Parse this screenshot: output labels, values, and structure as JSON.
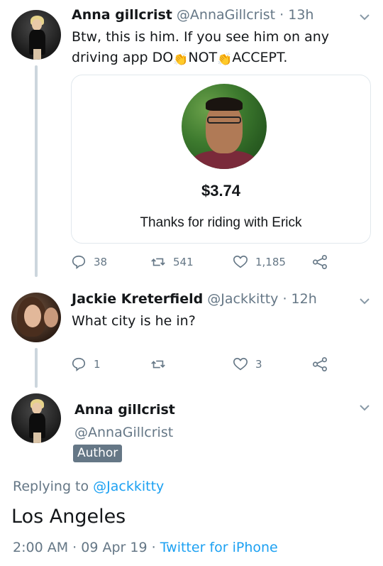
{
  "tweet1": {
    "name": "Anna gillcrist",
    "handle": "@AnnaGillcrist",
    "separator": "·",
    "time": "13h",
    "line1": "Btw, this is him. If you see him on any",
    "line2_a": "driving app DO",
    "line2_b": "NOT",
    "line2_c": "ACCEPT.",
    "emoji": "👏",
    "card": {
      "amount": "$3.74",
      "thanks": "Thanks for riding with Erick"
    },
    "actions": {
      "replies": "38",
      "retweets": "541",
      "likes": "1,185"
    }
  },
  "tweet2": {
    "name": "Jackie Kreterfield",
    "handle": "@Jackkitty",
    "separator": "·",
    "time": "12h",
    "text": "What city is he in?",
    "actions": {
      "replies": "1",
      "retweets": "",
      "likes": "3"
    }
  },
  "tweet3": {
    "name": "Anna gillcrist",
    "handle": "@AnnaGillcrist",
    "badge": "Author",
    "replying_prefix": "Replying to",
    "replying_to": "@Jackkitty",
    "text": "Los Angeles",
    "time": "2:00 AM",
    "date": "09 Apr 19",
    "sep1": "·",
    "sep2": "·",
    "source": "Twitter for iPhone"
  },
  "icons": {
    "reply": "reply-icon",
    "retweet": "retweet-icon",
    "like": "heart-icon",
    "share": "share-icon",
    "menu": "chevron-down-icon"
  },
  "colors": {
    "link": "#1da1f2",
    "muted": "#657786",
    "thread_line": "#ccd6dd",
    "badge_bg": "#657786"
  }
}
